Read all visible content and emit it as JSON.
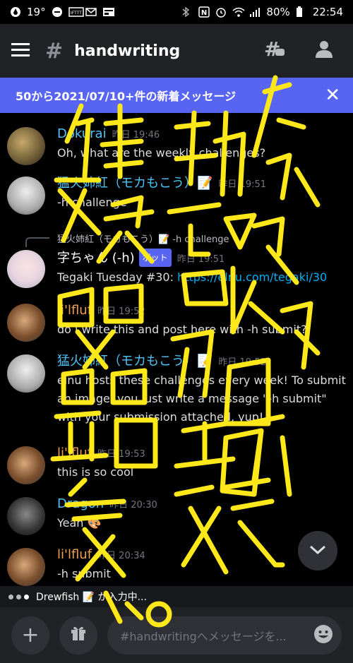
{
  "status_bar": {
    "temperature": "19°",
    "battery": "80%",
    "time": "22:54",
    "icons": [
      "nfc-icon",
      "alarm-icon",
      "wifi-icon",
      "signal-icon",
      "battery-icon",
      "bluetooth-icon"
    ]
  },
  "header": {
    "channel_name": "handwriting",
    "menu_icon": "hamburger-icon",
    "threads_icon": "threads-icon",
    "members_icon": "members-icon"
  },
  "banner": {
    "text": "50から2021/07/10+件の新着メッセージ",
    "close": "✕"
  },
  "messages": [
    {
      "author": "Dokurai",
      "author_color": "#4fc3f7",
      "time": "昨日 19:46",
      "text": "Oh, what are the weekly challenges?"
    },
    {
      "author": "猛火姉紅（モカもこう）📝",
      "author_color": "#4fc3f7",
      "time": "昨日 19:51",
      "text": "-h challenge"
    },
    {
      "reply_author": "猛火姉紅（モカもこう）📝",
      "reply_text": "-h challenge",
      "author": "字ちゃん (-h)",
      "author_color": "#ffffff",
      "bot_tag": "ボット",
      "time": "昨日 19:51",
      "text_prefix": "Tegaki Tuesday #30: ",
      "link": "https://elnu.com/tegaki/30"
    },
    {
      "author": "li'lfluf",
      "author_color": "#f0a04b",
      "time": "昨日 19:52",
      "text": "do i write this and post here with -h submit?"
    },
    {
      "author": "猛火姉紅（モカもこう）📝",
      "author_color": "#4fc3f7",
      "time": "昨日 19:52",
      "text": "elnu hosts these challenges every week! To submit an image, you just write a message \"-h submit\" with your submission attached, yup!"
    },
    {
      "author": "li'lfluf",
      "author_color": "#f0a04b",
      "time": "昨日 19:53",
      "text": "this is so cool"
    },
    {
      "author": "Dragon",
      "author_color": "#4fc3f7",
      "time": "昨日 20:30",
      "text": "Yeah 🎨"
    },
    {
      "author": "li'lfluf",
      "author_color": "#f0a04b",
      "time": "昨日 20:34",
      "text": "-h submit"
    }
  ],
  "typing": {
    "text": "Drewfish 📝 が入力中..."
  },
  "composer": {
    "placeholder": "#handwritingへメッセージを..."
  },
  "overlay_handwriting": {
    "color": "#ffe81a",
    "text": "病気た 邪気が ついた 瘴気だ 吸 出 器 病気 か。"
  }
}
